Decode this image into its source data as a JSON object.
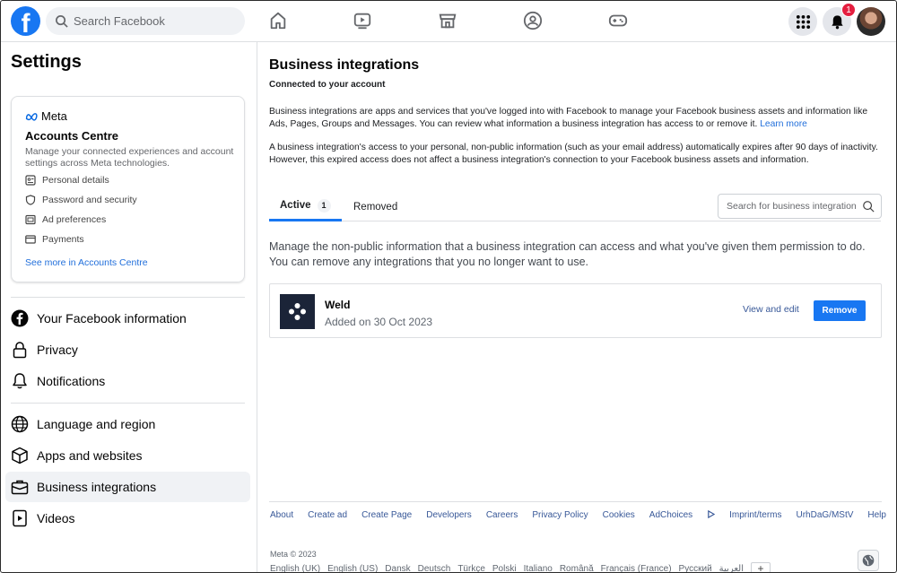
{
  "topbar": {
    "logo_letter": "f",
    "search_placeholder": "Search Facebook",
    "nav_icons": [
      "home-icon",
      "watch-icon",
      "marketplace-icon",
      "groups-icon",
      "gaming-icon"
    ],
    "menu_icon": "grid-menu-icon",
    "notification_count": "1",
    "colors": {
      "brand": "#1877f2",
      "badge": "#e41e3f"
    }
  },
  "sidebar": {
    "title": "Settings",
    "accounts_centre": {
      "meta_label": "Meta",
      "title": "Accounts Centre",
      "description": "Manage your connected experiences and account settings across Meta technologies.",
      "items": [
        {
          "label": "Personal details",
          "icon": "id-card-icon"
        },
        {
          "label": "Password and security",
          "icon": "shield-icon"
        },
        {
          "label": "Ad preferences",
          "icon": "ad-preferences-icon"
        },
        {
          "label": "Payments",
          "icon": "credit-card-icon"
        }
      ],
      "see_more": "See more in Accounts Centre"
    },
    "items": [
      {
        "label": "Your Facebook information",
        "icon": "facebook-icon"
      },
      {
        "label": "Privacy",
        "icon": "lock-icon"
      },
      {
        "label": "Notifications",
        "icon": "bell-icon"
      },
      {
        "label": "Language and region",
        "icon": "globe-icon"
      },
      {
        "label": "Apps and websites",
        "icon": "cube-icon"
      },
      {
        "label": "Business integrations",
        "icon": "briefcase-icon",
        "active": true
      },
      {
        "label": "Videos",
        "icon": "video-icon"
      }
    ]
  },
  "main": {
    "title": "Business integrations",
    "subtitle": "Connected to your account",
    "para1": "Business integrations are apps and services that you've logged into with Facebook to manage your Facebook business assets and information like Ads, Pages, Groups and Messages. You can review what information a business integration has access to or remove it.",
    "learn_more": "Learn more",
    "para2": "A business integration's access to your personal, non-public information (such as your email address) automatically expires after 90 days of inactivity. However, this expired access does not affect a business integration's connection to your Facebook business assets and information.",
    "tabs": [
      {
        "label": "Active",
        "count": "1",
        "active": true
      },
      {
        "label": "Removed"
      }
    ],
    "search_placeholder": "Search for business integrations",
    "manage_text": "Manage the non-public information that a business integration can access and what you've given them permission to do. You can remove any integrations that you no longer want to use.",
    "integration": {
      "name": "Weld",
      "added": "Added on 30 Oct 2023",
      "view_edit": "View and edit",
      "remove": "Remove"
    }
  },
  "footer": {
    "links": [
      "About",
      "Create ad",
      "Create Page",
      "Developers",
      "Careers",
      "Privacy Policy",
      "Cookies",
      "AdChoices",
      "Imprint/terms",
      "UrhDaG/MStV",
      "Help"
    ],
    "copyright": "Meta © 2023",
    "languages": [
      "English (UK)",
      "English (US)",
      "Dansk",
      "Deutsch",
      "Türkçe",
      "Polski",
      "Italiano",
      "Română",
      "Français (France)",
      "Русский",
      "العربية"
    ],
    "plus": "+"
  }
}
